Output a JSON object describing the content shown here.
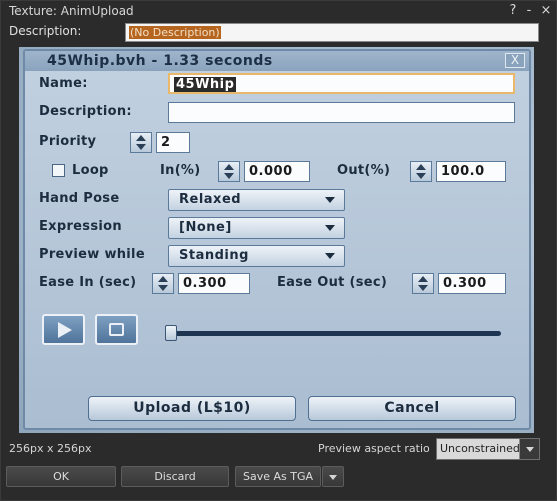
{
  "window": {
    "title": "Texture: AnimUpload",
    "help_icon": "?",
    "minimize_icon": "-",
    "close_icon": "×"
  },
  "description": {
    "label": "Description:",
    "value": "(No Description)"
  },
  "anim_dialog": {
    "title": "45Whip.bvh - 1.33 seconds",
    "close_icon": "X",
    "name_label": "Name:",
    "name_value": "45Whip",
    "description_label": "Description:",
    "description_value": "",
    "priority_label": "Priority",
    "priority_value": "2",
    "loop_label": "Loop",
    "in_label": "In(%)",
    "in_value": "0.000",
    "out_label": "Out(%)",
    "out_value": "100.0",
    "hand_pose_label": "Hand Pose",
    "hand_pose_value": "Relaxed",
    "expression_label": "Expression",
    "expression_value": "[None]",
    "preview_while_label": "Preview while",
    "preview_while_value": "Standing",
    "ease_in_label": "Ease In (sec)",
    "ease_in_value": "0.300",
    "ease_out_label": "Ease Out (sec)",
    "ease_out_value": "0.300",
    "upload_label": "Upload (L$10)",
    "cancel_label": "Cancel"
  },
  "footer": {
    "dimensions": "256px x 256px",
    "aspect_label": "Preview aspect ratio",
    "aspect_value": "Unconstrained",
    "ok_label": "OK",
    "discard_label": "Discard",
    "save_as_label": "Save As TGA"
  }
}
